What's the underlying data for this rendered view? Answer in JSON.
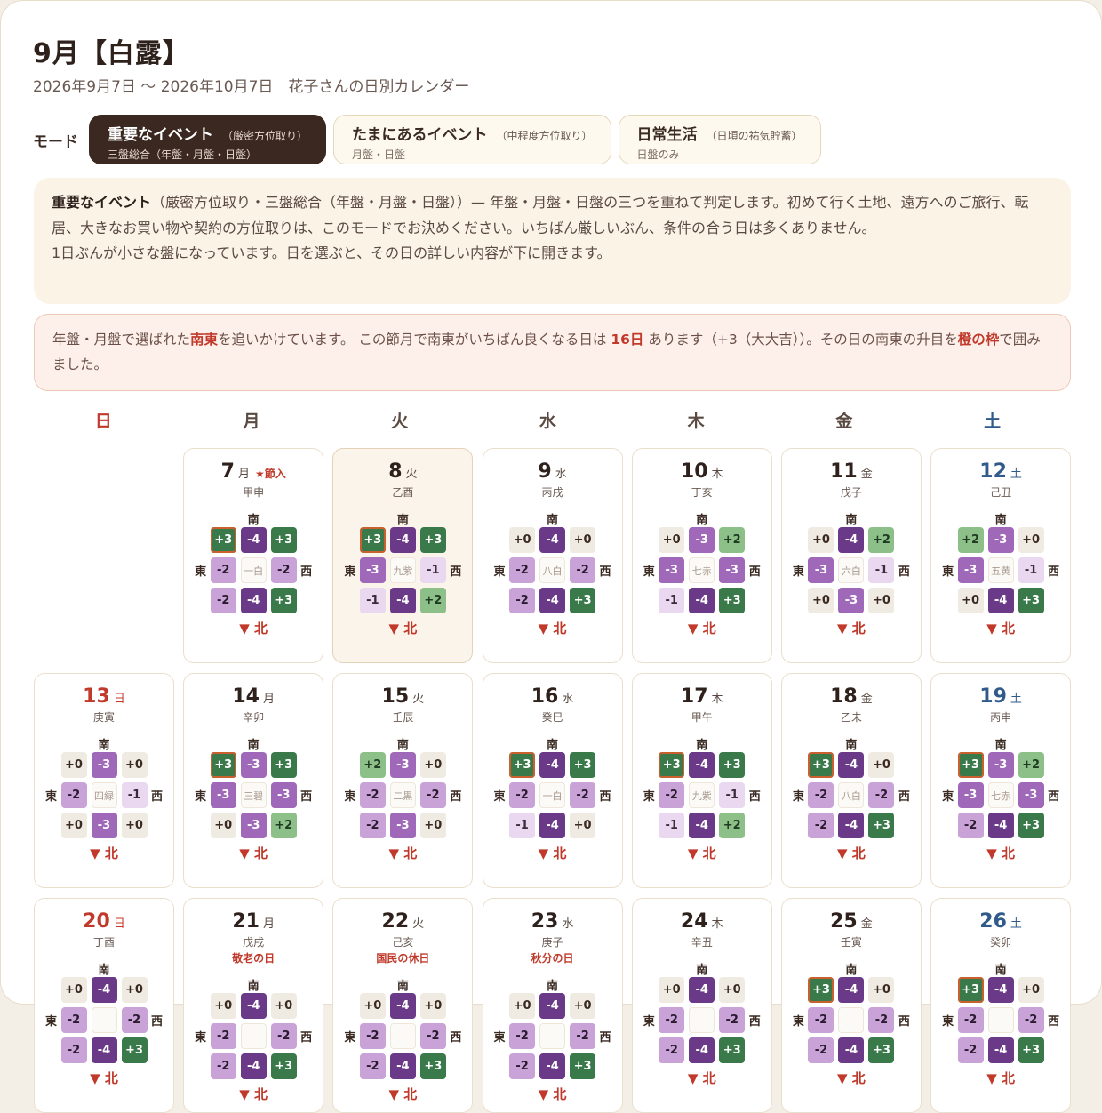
{
  "header": {
    "title": "9月【白露】",
    "subtitle": "2026年9月7日 〜 2026年10月7日　花子さんの日別カレンダー"
  },
  "mode": {
    "label": "モード",
    "options": [
      {
        "name": "重要なイベント",
        "note": "（厳密方位取り）",
        "sub": "三盤総合（年盤・月盤・日盤）",
        "active": true
      },
      {
        "name": "たまにあるイベント",
        "note": "（中程度方位取り）",
        "sub": "月盤・日盤",
        "active": false
      },
      {
        "name": "日常生活",
        "note": "（日頃の祐気貯蓄）",
        "sub": "日盤のみ",
        "active": false
      }
    ]
  },
  "info": {
    "bold": "重要なイベント",
    "line1": "（厳密方位取り・三盤総合（年盤・月盤・日盤））— 年盤・月盤・日盤の三つを重ねて判定します。初めて行く土地、遠方へのご旅行、転居、大きなお買い物や契約の方位取りは、このモードでお決めください。いちばん厳しいぶん、条件の合う日は多くありません。",
    "line2": "1日ぶんが小さな盤になっています。日を選ぶと、その日の詳しい内容が下に開きます。"
  },
  "notice": {
    "p1": "年盤・月盤で選ばれた",
    "dir": "南東",
    "p2": "を追いかけています。 この節月で南東がいちばん良くなる日は ",
    "days": "16日",
    "p3": " あります（+3（大大吉））。その日の南東の升目を",
    "frame": "橙の枠",
    "p4": "で囲みました。"
  },
  "weekdays": [
    "日",
    "月",
    "火",
    "水",
    "木",
    "金",
    "土"
  ],
  "labels": {
    "south": "南",
    "east": "東",
    "west": "西",
    "north": "▼ 北",
    "sekki": "★節入"
  },
  "days": [
    {
      "num": "7",
      "wd": "月",
      "kanshi": "甲申",
      "star": "Y",
      "center": "一白",
      "cells": [
        "+3",
        "-4",
        "+3",
        "-2",
        "-2",
        "-2",
        "-4",
        "+3"
      ],
      "ring": 0
    },
    {
      "num": "8",
      "wd": "火",
      "kanshi": "乙酉",
      "center": "九紫",
      "sel": "Y",
      "cells": [
        "+3",
        "-4",
        "+3",
        "-3",
        "-1",
        "-1",
        "-4",
        "+2"
      ],
      "ring": 0
    },
    {
      "num": "9",
      "wd": "水",
      "kanshi": "丙戌",
      "center": "八白",
      "cells": [
        "+0",
        "-4",
        "+0",
        "-2",
        "-2",
        "-2",
        "-4",
        "+3"
      ],
      "ring": -1
    },
    {
      "num": "10",
      "wd": "木",
      "kanshi": "丁亥",
      "center": "七赤",
      "cells": [
        "+0",
        "-3",
        "+2",
        "-3",
        "-3",
        "-1",
        "-4",
        "+3"
      ],
      "ring": -1
    },
    {
      "num": "11",
      "wd": "金",
      "kanshi": "戊子",
      "center": "六白",
      "cells": [
        "+0",
        "-4",
        "+2",
        "-3",
        "-1",
        "+0",
        "-3",
        "+0"
      ],
      "ring": -1
    },
    {
      "num": "12",
      "wd": "土",
      "kanshi": "己丑",
      "center": "五黄",
      "cells": [
        "+2",
        "-3",
        "+0",
        "-3",
        "-1",
        "+0",
        "-4",
        "+3"
      ],
      "ring": -1
    },
    {
      "num": "13",
      "wd": "日",
      "kanshi": "庚寅",
      "center": "四緑",
      "cells": [
        "+0",
        "-3",
        "+0",
        "-2",
        "-1",
        "+0",
        "-3",
        "+0"
      ],
      "ring": -1
    },
    {
      "num": "14",
      "wd": "月",
      "kanshi": "辛卯",
      "center": "三碧",
      "cells": [
        "+3",
        "-3",
        "+3",
        "-3",
        "-3",
        "+0",
        "-3",
        "+2"
      ],
      "ring": 0
    },
    {
      "num": "15",
      "wd": "火",
      "kanshi": "壬辰",
      "center": "二黒",
      "cells": [
        "+2",
        "-3",
        "+0",
        "-2",
        "-2",
        "-2",
        "-3",
        "+0"
      ],
      "ring": -1
    },
    {
      "num": "16",
      "wd": "水",
      "kanshi": "癸巳",
      "center": "一白",
      "cells": [
        "+3",
        "-4",
        "+3",
        "-2",
        "-2",
        "-1",
        "-4",
        "+0"
      ],
      "ring": 0
    },
    {
      "num": "17",
      "wd": "木",
      "kanshi": "甲午",
      "center": "九紫",
      "cells": [
        "+3",
        "-4",
        "+3",
        "-2",
        "-1",
        "-1",
        "-4",
        "+2"
      ],
      "ring": 0
    },
    {
      "num": "18",
      "wd": "金",
      "kanshi": "乙未",
      "center": "八白",
      "cells": [
        "+3",
        "-4",
        "+0",
        "-2",
        "-2",
        "-2",
        "-4",
        "+3"
      ],
      "ring": 0
    },
    {
      "num": "19",
      "wd": "土",
      "kanshi": "丙申",
      "center": "七赤",
      "cells": [
        "+3",
        "-3",
        "+2",
        "-3",
        "-3",
        "-2",
        "-4",
        "+3"
      ],
      "ring": 0
    },
    {
      "num": "20",
      "wd": "日",
      "kanshi": "丁酉",
      "center": "",
      "cells": [
        "+0",
        "-4",
        "+0",
        "-2",
        "-2",
        "-2",
        "-4",
        "+3"
      ],
      "ring": -1
    },
    {
      "num": "21",
      "wd": "月",
      "kanshi": "戊戌",
      "holiday": "敬老の日",
      "center": "",
      "cells": [
        "+0",
        "-4",
        "+0",
        "-2",
        "-2",
        "-2",
        "-4",
        "+3"
      ],
      "ring": -1
    },
    {
      "num": "22",
      "wd": "火",
      "kanshi": "己亥",
      "holiday": "国民の休日",
      "center": "",
      "cells": [
        "+0",
        "-4",
        "+0",
        "-2",
        "-2",
        "-2",
        "-4",
        "+3"
      ],
      "ring": -1
    },
    {
      "num": "23",
      "wd": "水",
      "kanshi": "庚子",
      "holiday": "秋分の日",
      "center": "",
      "cells": [
        "+0",
        "-4",
        "+0",
        "-2",
        "-2",
        "-2",
        "-4",
        "+3"
      ],
      "ring": -1
    },
    {
      "num": "24",
      "wd": "木",
      "kanshi": "辛丑",
      "center": "",
      "cells": [
        "+0",
        "-4",
        "+0",
        "-2",
        "-2",
        "-2",
        "-4",
        "+3"
      ],
      "ring": -1
    },
    {
      "num": "25",
      "wd": "金",
      "kanshi": "壬寅",
      "center": "",
      "cells": [
        "+3",
        "-4",
        "+0",
        "-2",
        "-2",
        "-2",
        "-4",
        "+3"
      ],
      "ring": 0
    },
    {
      "num": "26",
      "wd": "土",
      "kanshi": "癸卯",
      "center": "",
      "cells": [
        "+3",
        "-4",
        "+0",
        "-2",
        "-2",
        "-2",
        "-4",
        "+3"
      ],
      "ring": 0
    }
  ]
}
